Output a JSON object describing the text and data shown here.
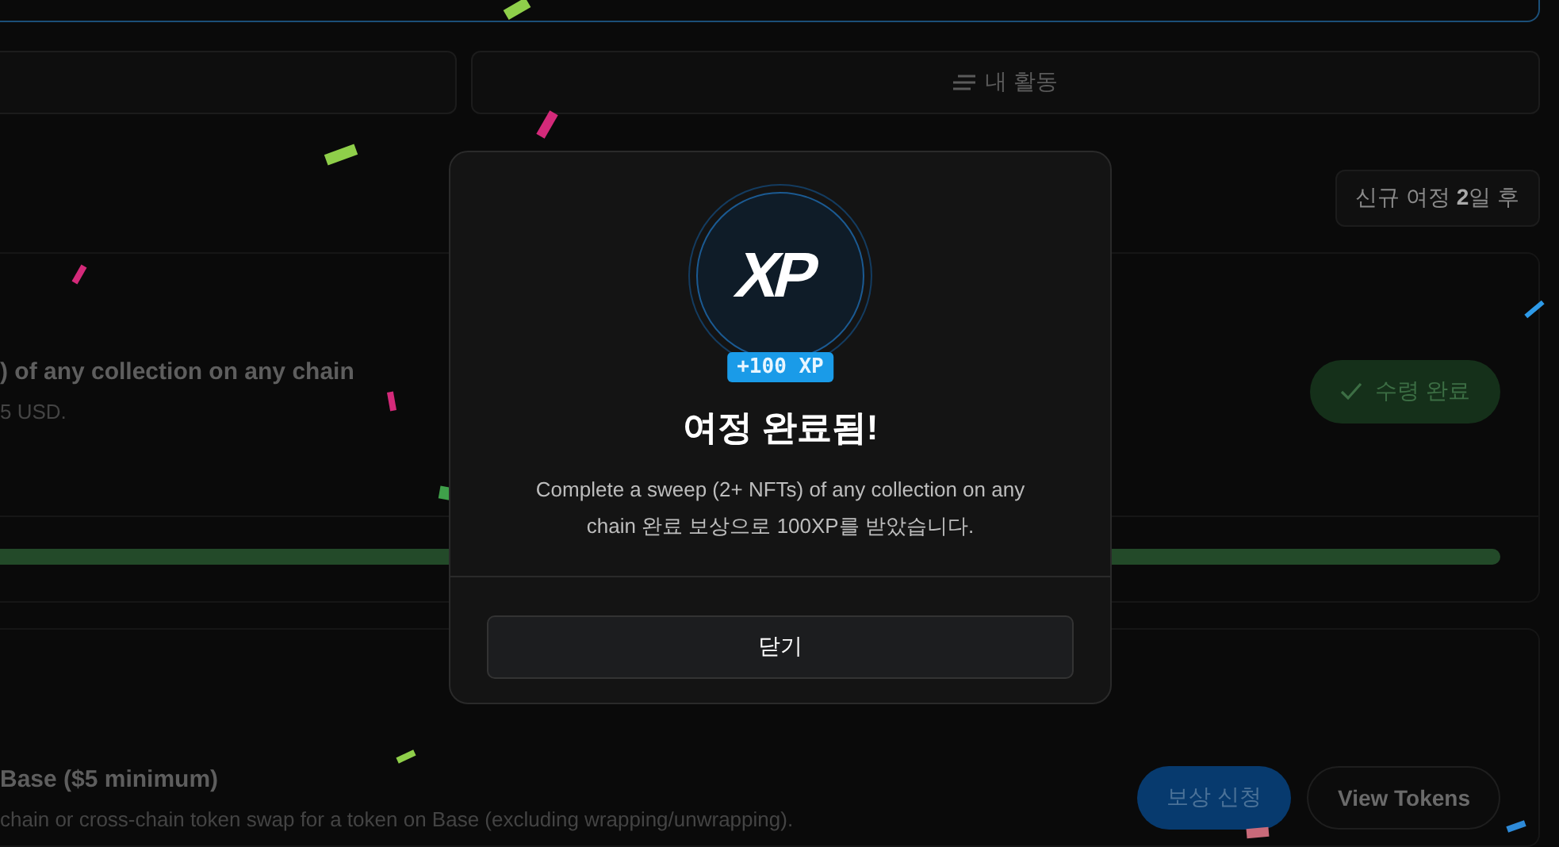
{
  "tabs": [
    {
      "kind": "blank"
    },
    {
      "kind": "labeled",
      "label": "내 활동"
    }
  ],
  "next_journey": "신규 여정 **2**일 후",
  "journeys": [
    {
      "title": ") of any collection on any chain",
      "subtitle": "5 USD.",
      "actions": [
        {
          "kind": "claimed",
          "label": "수령 완료"
        }
      ],
      "progress": {
        "level": 1
      }
    },
    {
      "title": "Base ($5 minimum)",
      "subtitle": "chain or cross-chain token swap for a token on Base (excluding wrapping/unwrapping).",
      "actions": [
        {
          "kind": "claim",
          "label": "보상 신청"
        },
        {
          "kind": "link",
          "label": "View Tokens"
        }
      ]
    }
  ],
  "modal": {
    "logo_text": "XP",
    "badge": "+100 XP",
    "title": "여정 완료됨!",
    "message": "Complete a sweep (2+ NFTs) of any collection on any chain 완료 보상으로 100XP를 받았습니다.",
    "close_button": "닫기"
  }
}
